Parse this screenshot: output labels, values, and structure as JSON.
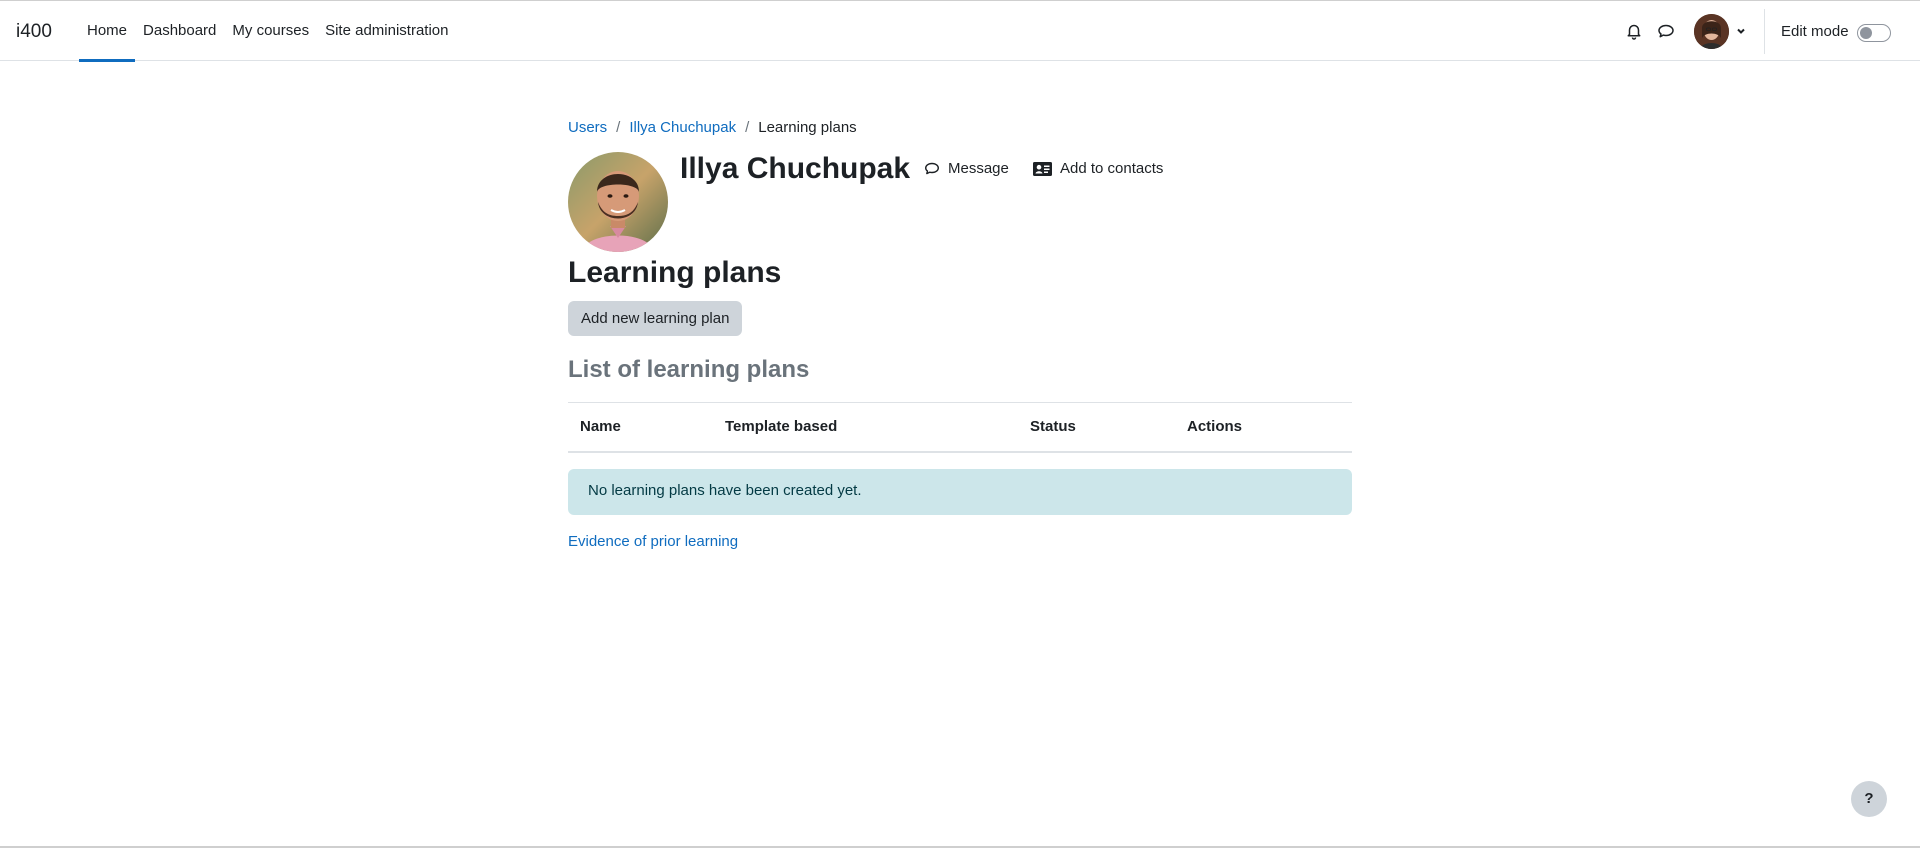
{
  "navbar": {
    "brand": "i400",
    "items": [
      {
        "label": "Home",
        "active": true
      },
      {
        "label": "Dashboard",
        "active": false
      },
      {
        "label": "My courses",
        "active": false
      },
      {
        "label": "Site administration",
        "active": false
      }
    ],
    "icons": [
      "bell-icon",
      "chat-bubble-icon",
      "chevron-down-icon"
    ],
    "edit_mode_label": "Edit mode",
    "edit_mode_on": false
  },
  "breadcrumb": {
    "items": [
      "Users",
      "Illya Chuchupak"
    ],
    "separator": "/",
    "current": "Learning plans"
  },
  "profile": {
    "name": "Illya Chuchupak",
    "message_label": "Message",
    "add_contact_label": "Add to contacts"
  },
  "page": {
    "title": "Learning plans",
    "add_button_label": "Add new learning plan",
    "list_title": "List of learning plans",
    "columns": [
      "Name",
      "Template based",
      "Status",
      "Actions"
    ],
    "empty_message": "No learning plans have been created yet.",
    "evidence_link": "Evidence of prior learning"
  },
  "help": {
    "label": "?"
  },
  "colors": {
    "accent": "#0f6cbf",
    "alert_bg": "#cce6ea",
    "button_bg": "#ced4da",
    "subtitle": "#6a737b"
  }
}
